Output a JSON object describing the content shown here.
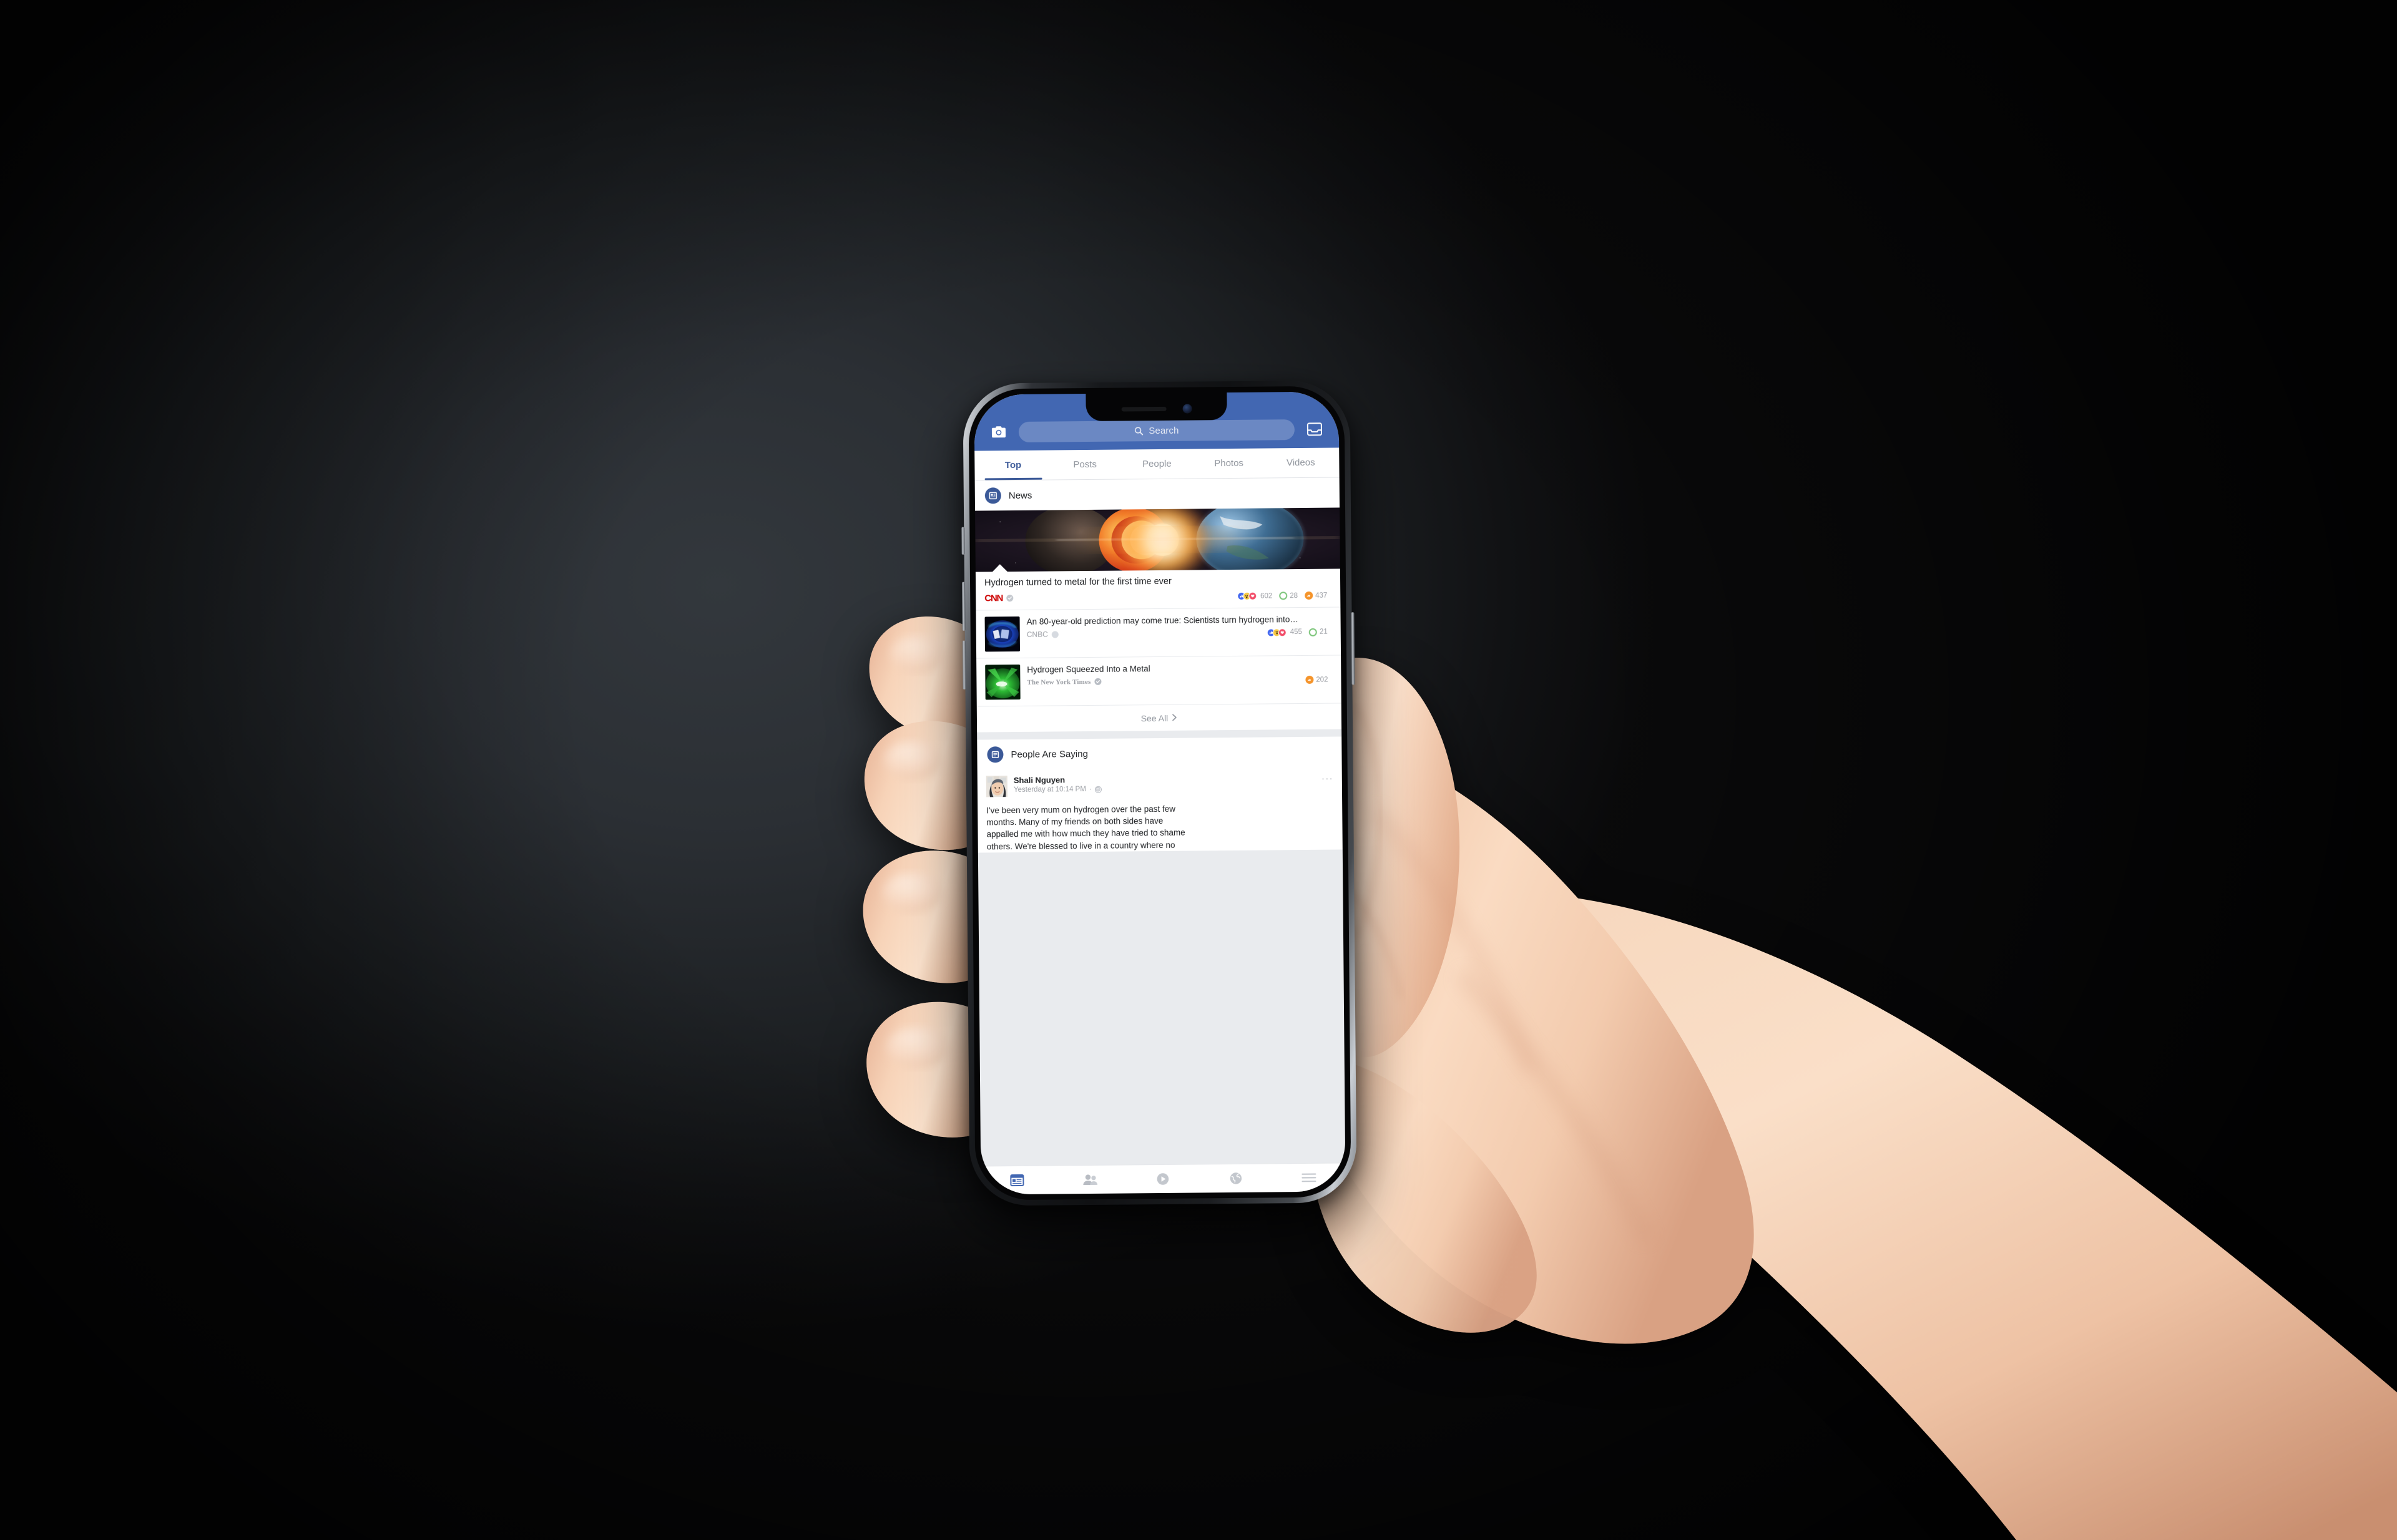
{
  "scene": {
    "description": "Hand holding an iPhone X displaying the Facebook app search results page",
    "background_color": "#2b2f34",
    "phone_frame_color": "#16181b"
  },
  "statusbar": {
    "notch_speaker": "speaker-slot",
    "notch_camera": "front-camera"
  },
  "topbar": {
    "camera_icon": "camera-icon",
    "messenger_icon": "messenger-inbox-icon",
    "background_color": "#4267b2"
  },
  "search": {
    "placeholder": "Search",
    "value": "Search",
    "icon": "search-icon"
  },
  "tabs": [
    {
      "label": "Top",
      "active": true
    },
    {
      "label": "Posts",
      "active": false
    },
    {
      "label": "People",
      "active": false
    },
    {
      "label": "Photos",
      "active": false
    },
    {
      "label": "Videos",
      "active": false
    }
  ],
  "news_section": {
    "title": "News",
    "icon": "news-article-icon",
    "hero": {
      "image_alt": "earth-cutaway-glowing-core",
      "title": "Hydrogen turned to metal for the first time ever",
      "source": "CNN",
      "source_verified": true,
      "reactions": [
        "like",
        "wow",
        "love"
      ],
      "reaction_count": "602",
      "comment_count": "28",
      "share_count": "437"
    },
    "articles": [
      {
        "thumb_alt": "blue-diamond-anvil-cell",
        "title": "An 80-year-old prediction may come true: Scientists turn hydrogen into…",
        "source": "CNBC",
        "source_verified": true,
        "reactions": [
          "like",
          "wow",
          "love"
        ],
        "reaction_count": "455",
        "comment_count": "21",
        "share_count": ""
      },
      {
        "thumb_alt": "green-crystal-metallic-hydrogen",
        "title": "Hydrogen Squeezed Into a Metal",
        "source": "The New York Times",
        "source_verified": true,
        "reactions": [],
        "reaction_count": "",
        "comment_count": "",
        "share_count": "202"
      }
    ],
    "see_all_label": "See All",
    "see_all_icon": "chevron-right-icon"
  },
  "people_section": {
    "title": "People Are Saying",
    "icon": "post-list-icon",
    "post": {
      "author": "Shali Nguyen",
      "timestamp": "Yesterday at 10:14 PM",
      "separator": "·",
      "privacy_icon": "globe-public-icon",
      "menu_icon": "ellipsis-icon",
      "avatar_alt": "profile-photo-woman-grey-hat",
      "body_lines": [
        "I've been very mum on hydrogen over the past few",
        "months. Many of my friends on both sides have",
        "appalled me with how much they have tried to shame",
        "others. We're blessed to live in a country where no"
      ]
    }
  },
  "bottomnav": [
    {
      "name": "news-feed-icon",
      "active": true
    },
    {
      "name": "friends-icon",
      "active": false
    },
    {
      "name": "video-play-icon",
      "active": false
    },
    {
      "name": "globe-notifications-icon",
      "active": false
    },
    {
      "name": "hamburger-menu-icon",
      "active": false
    }
  ],
  "colors": {
    "fb_blue": "#4267b2",
    "fb_accent": "#3b5998",
    "like_blue": "#4267f0",
    "wow_yellow": "#f7c945",
    "love_red": "#f24e6a",
    "comment_green": "#7cc57a",
    "share_orange": "#f5942b",
    "cnn_red": "#cc0000",
    "text_primary": "#1c1e21",
    "text_muted": "#9a9da3"
  }
}
